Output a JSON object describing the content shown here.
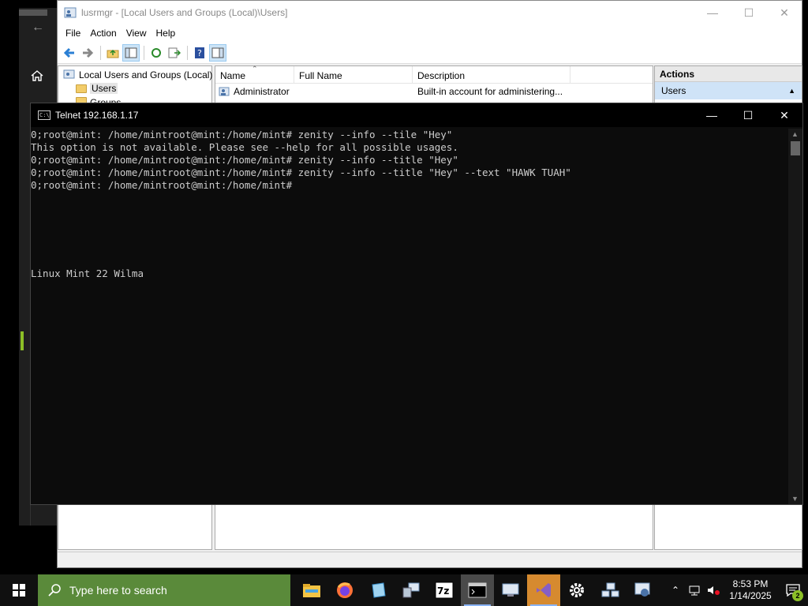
{
  "lusrmgr": {
    "title": "lusrmgr - [Local Users and Groups (Local)\\Users]",
    "menu": [
      "File",
      "Action",
      "View",
      "Help"
    ],
    "tree": {
      "root": "Local Users and Groups (Local)",
      "items": [
        "Users",
        "Groups"
      ]
    },
    "columns": [
      "Name",
      "Full Name",
      "Description"
    ],
    "rows": [
      {
        "name": "Administrator",
        "full_name": "",
        "description": "Built-in account for administering..."
      }
    ],
    "actions": {
      "header": "Actions",
      "section": "Users"
    }
  },
  "telnet": {
    "title": "Telnet 192.168.1.17",
    "lines": [
      "0;root@mint: /home/mintroot@mint:/home/mint# zenity --info --tile \"Hey\"",
      "This option is not available. Please see --help for all possible usages.",
      "0;root@mint: /home/mintroot@mint:/home/mint# zenity --info --title \"Hey\"",
      "0;root@mint: /home/mintroot@mint:/home/mint# zenity --info --title \"Hey\" --text \"HAWK TUAH\"",
      "0;root@mint: /home/mintroot@mint:/home/mint#",
      "",
      "",
      "",
      "",
      "",
      "",
      "Linux Mint 22 Wilma"
    ]
  },
  "taskbar": {
    "search_placeholder": "Type here to search",
    "time": "8:53 PM",
    "date": "1/14/2025",
    "notification_count": "2",
    "apps": [
      "file-explorer-icon",
      "firefox-icon",
      "notepad-icon",
      "network-computer-icon",
      "7zip-icon",
      "console-icon",
      "remote-desktop-icon",
      "visual-studio-icon",
      "settings-gear-icon",
      "network-admin-icon",
      "computer-management-icon"
    ]
  },
  "colors": {
    "console_bg": "#0c0c0c",
    "console_fg": "#cccccc",
    "search_bg": "#5a8a3a",
    "accent": "#8cbf26"
  }
}
